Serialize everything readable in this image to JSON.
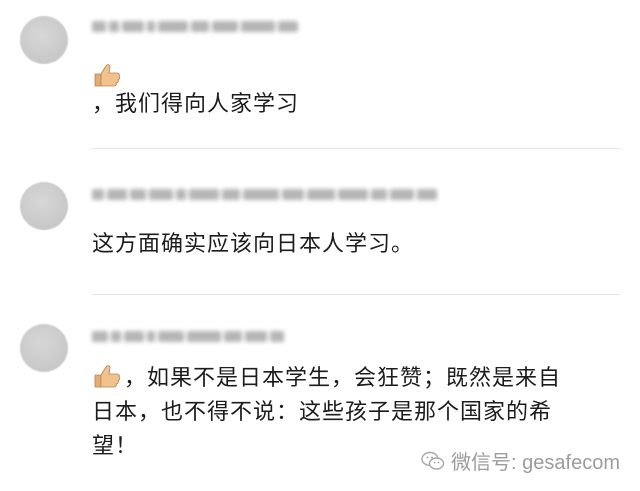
{
  "comments": [
    {
      "text": "，我们得向人家学习",
      "has_thumb_emoji": true
    },
    {
      "text": "这方面确实应该向日本人学习。",
      "has_thumb_emoji": false
    },
    {
      "line1": "，如果不是日本学生，会狂赞；既然是来自",
      "line2": "日本，也不得不说：这些孩子是那个国家的希",
      "line3": "望！",
      "has_thumb_emoji": true
    }
  ],
  "icons": {
    "thumb": "thumbs-up-icon",
    "watermark": "wechat-icon"
  },
  "watermark": {
    "text": "微信号: gesafecom"
  },
  "colors": {
    "text": "#1c1c1c",
    "divider": "#e6e6e6",
    "watermark": "#9c9c9c",
    "thumb": "#f2c28d"
  }
}
